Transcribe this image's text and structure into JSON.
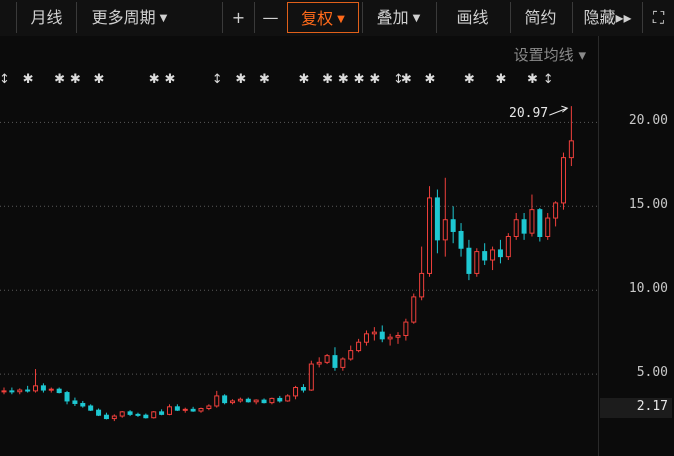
{
  "toolbar": {
    "items": [
      {
        "label": "",
        "caret": false,
        "active": false
      },
      {
        "label": "月线",
        "caret": false,
        "active": false
      },
      {
        "label": "更多周期",
        "caret": true,
        "active": false
      },
      {
        "label": "+",
        "caret": false,
        "active": false
      },
      {
        "label": "—",
        "caret": false,
        "active": false
      },
      {
        "label": "复权",
        "caret": true,
        "active": true
      },
      {
        "label": "叠加",
        "caret": true,
        "active": false
      },
      {
        "label": "画线",
        "caret": false,
        "active": false
      },
      {
        "label": "简约",
        "caret": false,
        "active": false
      },
      {
        "label": "隐藏▸▸",
        "caret": false,
        "active": false
      },
      {
        "label": "⛶",
        "caret": false,
        "active": false
      }
    ],
    "caret_glyph": "▼"
  },
  "ma_setting": {
    "label": "设置均线",
    "caret": "▾"
  },
  "colors": {
    "up": "#f0403c",
    "down": "#1ec8d2",
    "grid": "#5a5a5a",
    "accent": "#e0601a"
  },
  "chart_data": {
    "type": "candlestick",
    "y_ticks": [
      "20.00",
      "15.00",
      "10.00",
      "5.00"
    ],
    "y_tick_values": [
      20,
      15,
      10,
      5
    ],
    "ylim": [
      0.2,
      22.8
    ],
    "grid": "dotted-horizontal",
    "current_price_label": "2.17",
    "current_price": 2.17,
    "max_label": "20.97",
    "max_value": 20.97,
    "event_marks": [
      {
        "i": 0,
        "glyph": "↕"
      },
      {
        "i": 3,
        "glyph": "✱"
      },
      {
        "i": 7,
        "glyph": "✱"
      },
      {
        "i": 9,
        "glyph": "✱"
      },
      {
        "i": 12,
        "glyph": "✱"
      },
      {
        "i": 19,
        "glyph": "✱"
      },
      {
        "i": 21,
        "glyph": "✱"
      },
      {
        "i": 27,
        "glyph": "↕"
      },
      {
        "i": 30,
        "glyph": "✱"
      },
      {
        "i": 33,
        "glyph": "✱"
      },
      {
        "i": 38,
        "glyph": "✱"
      },
      {
        "i": 41,
        "glyph": "✱"
      },
      {
        "i": 43,
        "glyph": "✱"
      },
      {
        "i": 45,
        "glyph": "✱"
      },
      {
        "i": 47,
        "glyph": "✱"
      },
      {
        "i": 50,
        "glyph": "↕"
      },
      {
        "i": 51,
        "glyph": "✱"
      },
      {
        "i": 54,
        "glyph": "✱"
      },
      {
        "i": 59,
        "glyph": "✱"
      },
      {
        "i": 63,
        "glyph": "✱"
      },
      {
        "i": 67,
        "glyph": "✱"
      },
      {
        "i": 69,
        "glyph": "↕"
      }
    ],
    "candles": [
      {
        "o": 4.0,
        "h": 4.2,
        "l": 3.8,
        "c": 4.0
      },
      {
        "o": 4.0,
        "h": 4.2,
        "l": 3.8,
        "c": 3.95
      },
      {
        "o": 3.95,
        "h": 4.15,
        "l": 3.8,
        "c": 4.05
      },
      {
        "o": 4.05,
        "h": 4.3,
        "l": 3.9,
        "c": 4.0
      },
      {
        "o": 4.0,
        "h": 5.3,
        "l": 3.9,
        "c": 4.3
      },
      {
        "o": 4.3,
        "h": 4.45,
        "l": 3.9,
        "c": 4.05
      },
      {
        "o": 4.05,
        "h": 4.2,
        "l": 3.9,
        "c": 4.1
      },
      {
        "o": 4.1,
        "h": 4.2,
        "l": 3.85,
        "c": 3.9
      },
      {
        "o": 3.9,
        "h": 4.0,
        "l": 3.2,
        "c": 3.4
      },
      {
        "o": 3.4,
        "h": 3.6,
        "l": 3.1,
        "c": 3.25
      },
      {
        "o": 3.25,
        "h": 3.4,
        "l": 3.0,
        "c": 3.1
      },
      {
        "o": 3.1,
        "h": 3.2,
        "l": 2.8,
        "c": 2.85
      },
      {
        "o": 2.85,
        "h": 2.95,
        "l": 2.5,
        "c": 2.55
      },
      {
        "o": 2.55,
        "h": 2.7,
        "l": 2.3,
        "c": 2.35
      },
      {
        "o": 2.35,
        "h": 2.6,
        "l": 2.2,
        "c": 2.5
      },
      {
        "o": 2.5,
        "h": 2.8,
        "l": 2.4,
        "c": 2.75
      },
      {
        "o": 2.75,
        "h": 2.85,
        "l": 2.5,
        "c": 2.6
      },
      {
        "o": 2.6,
        "h": 2.7,
        "l": 2.45,
        "c": 2.55
      },
      {
        "o": 2.55,
        "h": 2.65,
        "l": 2.35,
        "c": 2.4
      },
      {
        "o": 2.4,
        "h": 2.8,
        "l": 2.35,
        "c": 2.75
      },
      {
        "o": 2.75,
        "h": 2.9,
        "l": 2.55,
        "c": 2.6
      },
      {
        "o": 2.6,
        "h": 3.2,
        "l": 2.55,
        "c": 3.05
      },
      {
        "o": 3.05,
        "h": 3.2,
        "l": 2.8,
        "c": 2.85
      },
      {
        "o": 2.85,
        "h": 3.0,
        "l": 2.7,
        "c": 2.9
      },
      {
        "o": 2.9,
        "h": 3.05,
        "l": 2.75,
        "c": 2.8
      },
      {
        "o": 2.8,
        "h": 3.0,
        "l": 2.7,
        "c": 2.95
      },
      {
        "o": 2.95,
        "h": 3.2,
        "l": 2.85,
        "c": 3.1
      },
      {
        "o": 3.1,
        "h": 4.0,
        "l": 3.0,
        "c": 3.7
      },
      {
        "o": 3.7,
        "h": 3.8,
        "l": 3.2,
        "c": 3.3
      },
      {
        "o": 3.3,
        "h": 3.5,
        "l": 3.2,
        "c": 3.4
      },
      {
        "o": 3.4,
        "h": 3.6,
        "l": 3.3,
        "c": 3.5
      },
      {
        "o": 3.5,
        "h": 3.6,
        "l": 3.3,
        "c": 3.35
      },
      {
        "o": 3.35,
        "h": 3.5,
        "l": 3.2,
        "c": 3.45
      },
      {
        "o": 3.45,
        "h": 3.55,
        "l": 3.25,
        "c": 3.3
      },
      {
        "o": 3.3,
        "h": 3.6,
        "l": 3.2,
        "c": 3.55
      },
      {
        "o": 3.55,
        "h": 3.7,
        "l": 3.3,
        "c": 3.4
      },
      {
        "o": 3.4,
        "h": 3.8,
        "l": 3.35,
        "c": 3.7
      },
      {
        "o": 3.7,
        "h": 4.3,
        "l": 3.5,
        "c": 4.2
      },
      {
        "o": 4.2,
        "h": 4.4,
        "l": 3.9,
        "c": 4.05
      },
      {
        "o": 4.05,
        "h": 5.8,
        "l": 4.0,
        "c": 5.6
      },
      {
        "o": 5.6,
        "h": 6.0,
        "l": 5.4,
        "c": 5.7
      },
      {
        "o": 5.7,
        "h": 6.2,
        "l": 5.6,
        "c": 6.1
      },
      {
        "o": 6.1,
        "h": 6.6,
        "l": 5.2,
        "c": 5.4
      },
      {
        "o": 5.4,
        "h": 6.0,
        "l": 5.2,
        "c": 5.9
      },
      {
        "o": 5.9,
        "h": 6.7,
        "l": 5.8,
        "c": 6.4
      },
      {
        "o": 6.4,
        "h": 7.1,
        "l": 6.3,
        "c": 6.9
      },
      {
        "o": 6.9,
        "h": 7.6,
        "l": 6.7,
        "c": 7.4
      },
      {
        "o": 7.4,
        "h": 7.8,
        "l": 7.0,
        "c": 7.5
      },
      {
        "o": 7.5,
        "h": 7.9,
        "l": 6.9,
        "c": 7.1
      },
      {
        "o": 7.1,
        "h": 7.4,
        "l": 6.7,
        "c": 7.2
      },
      {
        "o": 7.2,
        "h": 7.5,
        "l": 6.8,
        "c": 7.3
      },
      {
        "o": 7.3,
        "h": 8.3,
        "l": 7.0,
        "c": 8.1
      },
      {
        "o": 8.1,
        "h": 9.8,
        "l": 8.0,
        "c": 9.6
      },
      {
        "o": 9.6,
        "h": 12.6,
        "l": 9.4,
        "c": 11.0
      },
      {
        "o": 11.0,
        "h": 16.2,
        "l": 10.8,
        "c": 15.5
      },
      {
        "o": 15.5,
        "h": 16.0,
        "l": 12.2,
        "c": 13.0
      },
      {
        "o": 13.0,
        "h": 16.7,
        "l": 12.0,
        "c": 14.2
      },
      {
        "o": 14.2,
        "h": 15.0,
        "l": 12.8,
        "c": 13.5
      },
      {
        "o": 13.5,
        "h": 14.0,
        "l": 12.0,
        "c": 12.5
      },
      {
        "o": 12.5,
        "h": 13.0,
        "l": 10.6,
        "c": 11.0
      },
      {
        "o": 11.0,
        "h": 12.5,
        "l": 10.8,
        "c": 12.3
      },
      {
        "o": 12.3,
        "h": 12.8,
        "l": 11.5,
        "c": 11.8
      },
      {
        "o": 11.8,
        "h": 12.6,
        "l": 11.2,
        "c": 12.4
      },
      {
        "o": 12.4,
        "h": 13.0,
        "l": 11.6,
        "c": 12.0
      },
      {
        "o": 12.0,
        "h": 13.4,
        "l": 11.8,
        "c": 13.2
      },
      {
        "o": 13.2,
        "h": 14.6,
        "l": 13.0,
        "c": 14.2
      },
      {
        "o": 14.2,
        "h": 14.6,
        "l": 13.0,
        "c": 13.4
      },
      {
        "o": 13.4,
        "h": 15.7,
        "l": 13.2,
        "c": 14.8
      },
      {
        "o": 14.8,
        "h": 14.9,
        "l": 12.9,
        "c": 13.2
      },
      {
        "o": 13.2,
        "h": 14.6,
        "l": 13.0,
        "c": 14.3
      },
      {
        "o": 14.3,
        "h": 15.3,
        "l": 13.8,
        "c": 15.2
      },
      {
        "o": 15.2,
        "h": 18.2,
        "l": 14.8,
        "c": 17.9
      },
      {
        "o": 17.9,
        "h": 20.97,
        "l": 17.4,
        "c": 18.9
      }
    ]
  }
}
